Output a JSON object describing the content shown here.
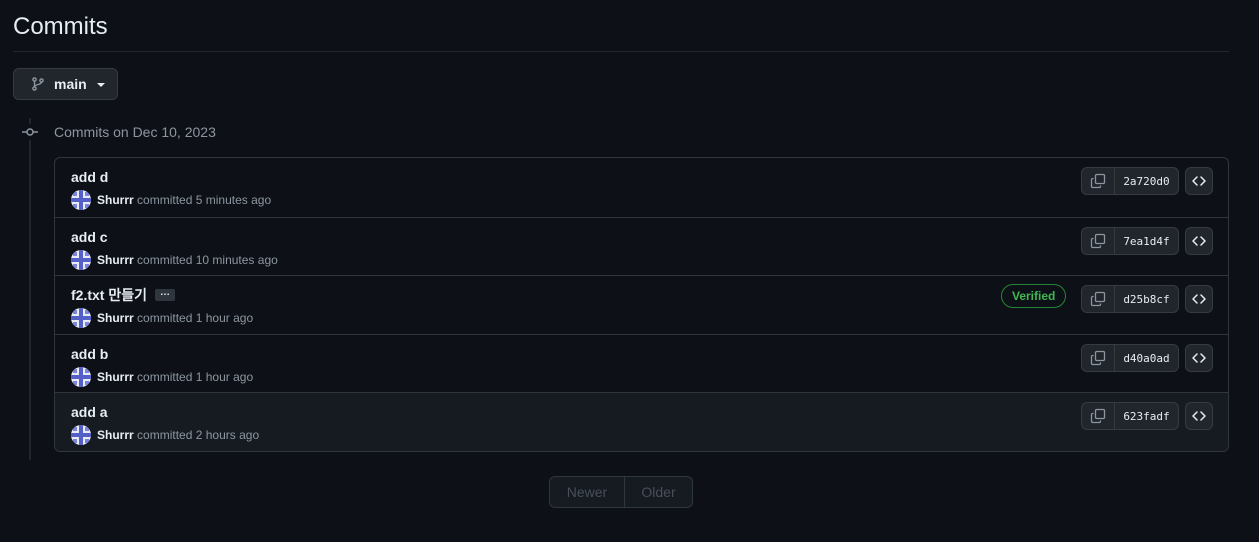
{
  "page": {
    "title": "Commits"
  },
  "branch": {
    "name": "main",
    "icon": "git-branch-icon"
  },
  "group": {
    "heading": "Commits on Dec 10, 2023"
  },
  "commits": [
    {
      "title": "add d",
      "author": "Shurrr",
      "action": "committed",
      "time": "5 minutes ago",
      "sha": "2a720d0",
      "verified": "",
      "has_ellipsis": false
    },
    {
      "title": "add c",
      "author": "Shurrr",
      "action": "committed",
      "time": "10 minutes ago",
      "sha": "7ea1d4f",
      "verified": "",
      "has_ellipsis": false
    },
    {
      "title": "f2.txt 만들기",
      "author": "Shurrr",
      "action": "committed",
      "time": "1 hour ago",
      "sha": "d25b8cf",
      "verified": "Verified",
      "has_ellipsis": true,
      "ellipsis_label": "…"
    },
    {
      "title": "add b",
      "author": "Shurrr",
      "action": "committed",
      "time": "1 hour ago",
      "sha": "d40a0ad",
      "verified": "",
      "has_ellipsis": false
    },
    {
      "title": "add a",
      "author": "Shurrr",
      "action": "committed",
      "time": "2 hours ago",
      "sha": "623fadf",
      "verified": "",
      "has_ellipsis": false
    }
  ],
  "pagination": {
    "newer": "Newer",
    "older": "Older"
  },
  "colors": {
    "background": "#0d1117",
    "border": "#30363d",
    "verified": "#3fb950",
    "muted_text": "#8d96a0",
    "avatar_blue": "#5460c8"
  }
}
